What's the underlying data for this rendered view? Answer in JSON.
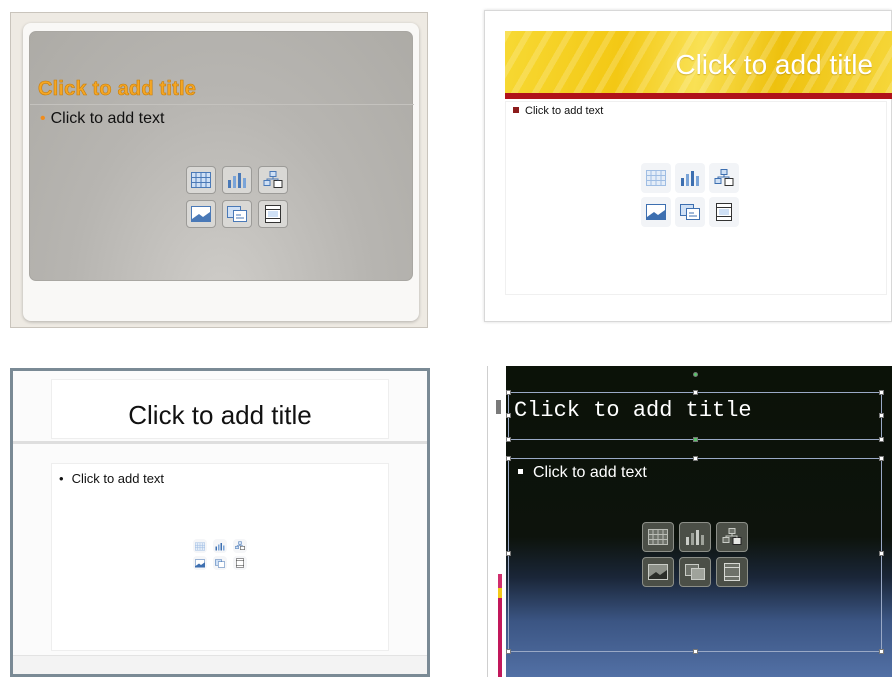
{
  "slides": [
    {
      "title": "Click to add title",
      "body": "Click to add text"
    },
    {
      "title": "Click to add title",
      "body": "Click to add text"
    },
    {
      "title": "Click to add title",
      "body": "Click to add text"
    },
    {
      "title": "Click to add title",
      "body": "Click to add text"
    }
  ],
  "placeholder_icons": [
    "table-icon",
    "chart-icon",
    "smartart-icon",
    "picture-icon",
    "clip-art-icon",
    "movie-icon"
  ],
  "colors": {
    "slide1_title": "#f5a623",
    "slide1_bullet": "#f08c1c",
    "slide2_band": "#f3c814",
    "slide2_rule": "#b0121a",
    "slide4_background": "#0b1208",
    "slide4_gradient_end": "#5270a5"
  }
}
